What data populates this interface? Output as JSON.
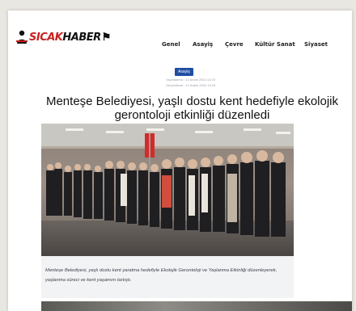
{
  "site": {
    "logo_red": "SICAK",
    "logo_black": "HABER"
  },
  "nav": {
    "items": [
      "Genel",
      "Asayiş",
      "Çevre",
      "Kültür Sanat",
      "Siyaset"
    ]
  },
  "article": {
    "category": "Asayiş",
    "published": "Yayınlanma : 12 Aralık 2024 13:15",
    "updated": "Güncelleme : 12 Aralık 2024 13:15",
    "title": "Menteşe Belediyesi, yaşlı dostu kent hedefiyle ekolojik gerontoloji etkinliği düzenledi",
    "caption": "Menteşe Belediyesi, yaşlı dostu kent yaratma hedefiyle Ekolojik Gerontoloji ve Yaşlanma Etkinliği düzenleyerek, yaşlanma süreci ve kent yaşamını tartıştı."
  },
  "colors": {
    "brand_red": "#c8201f",
    "category_blue": "#1f4fa3"
  },
  "icons": {
    "logo_mark": "person-silhouette-icon"
  }
}
